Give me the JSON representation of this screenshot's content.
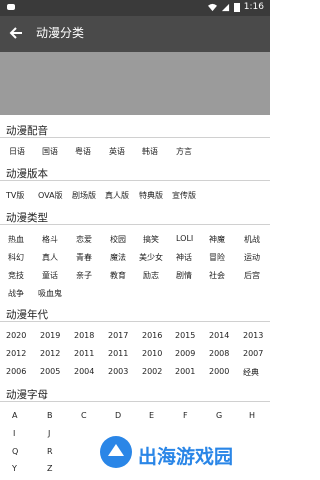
{
  "status": {
    "left_icon": "game-icon",
    "time": "1:16",
    "icons": [
      "wifi-icon",
      "signal-icon",
      "battery-icon"
    ]
  },
  "toolbar": {
    "title": "动漫分类"
  },
  "sections": [
    {
      "title": "动漫配音",
      "rows": [
        [
          "日语",
          "国语",
          "粤语",
          "英语",
          "韩语",
          "方言"
        ]
      ]
    },
    {
      "title": "动漫版本",
      "rows": [
        [
          "TV版",
          "OVA版",
          "剧场版",
          "真人版",
          "特典版",
          "宣传版"
        ]
      ]
    },
    {
      "title": "动漫类型",
      "rows": [
        [
          "热血",
          "格斗",
          "恋爱",
          "校园",
          "搞笑",
          "LOLI",
          "神魔",
          "机战"
        ],
        [
          "科幻",
          "真人",
          "青春",
          "魔法",
          "美少女",
          "神话",
          "冒险",
          "运动"
        ],
        [
          "竞技",
          "童话",
          "亲子",
          "教育",
          "励志",
          "剧情",
          "社会",
          "后宫"
        ],
        [
          "战争",
          "吸血鬼"
        ]
      ]
    },
    {
      "title": "动漫年代",
      "rows": [
        [
          "2020",
          "2019",
          "2018",
          "2017",
          "2016",
          "2015",
          "2014",
          "2013"
        ],
        [
          "2012",
          "2012",
          "2011",
          "2011",
          "2010",
          "2009",
          "2008",
          "2007"
        ],
        [
          "2006",
          "2005",
          "2004",
          "2003",
          "2002",
          "2001",
          "2000",
          "经典"
        ]
      ]
    },
    {
      "title": "动漫字母",
      "rows": [
        [
          "A",
          "B",
          "C",
          "D",
          "E",
          "F",
          "G",
          "H"
        ],
        [
          "I",
          "J"
        ],
        [
          "Q",
          "R"
        ],
        [
          "Y",
          "Z"
        ]
      ]
    }
  ],
  "watermark": {
    "text": "出海游戏园"
  },
  "colors": {
    "statusbar": "#3a3a3a",
    "toolbar": "#4a4a4a",
    "dim": "#9b9b9b",
    "watermark": "#2a86e7"
  }
}
